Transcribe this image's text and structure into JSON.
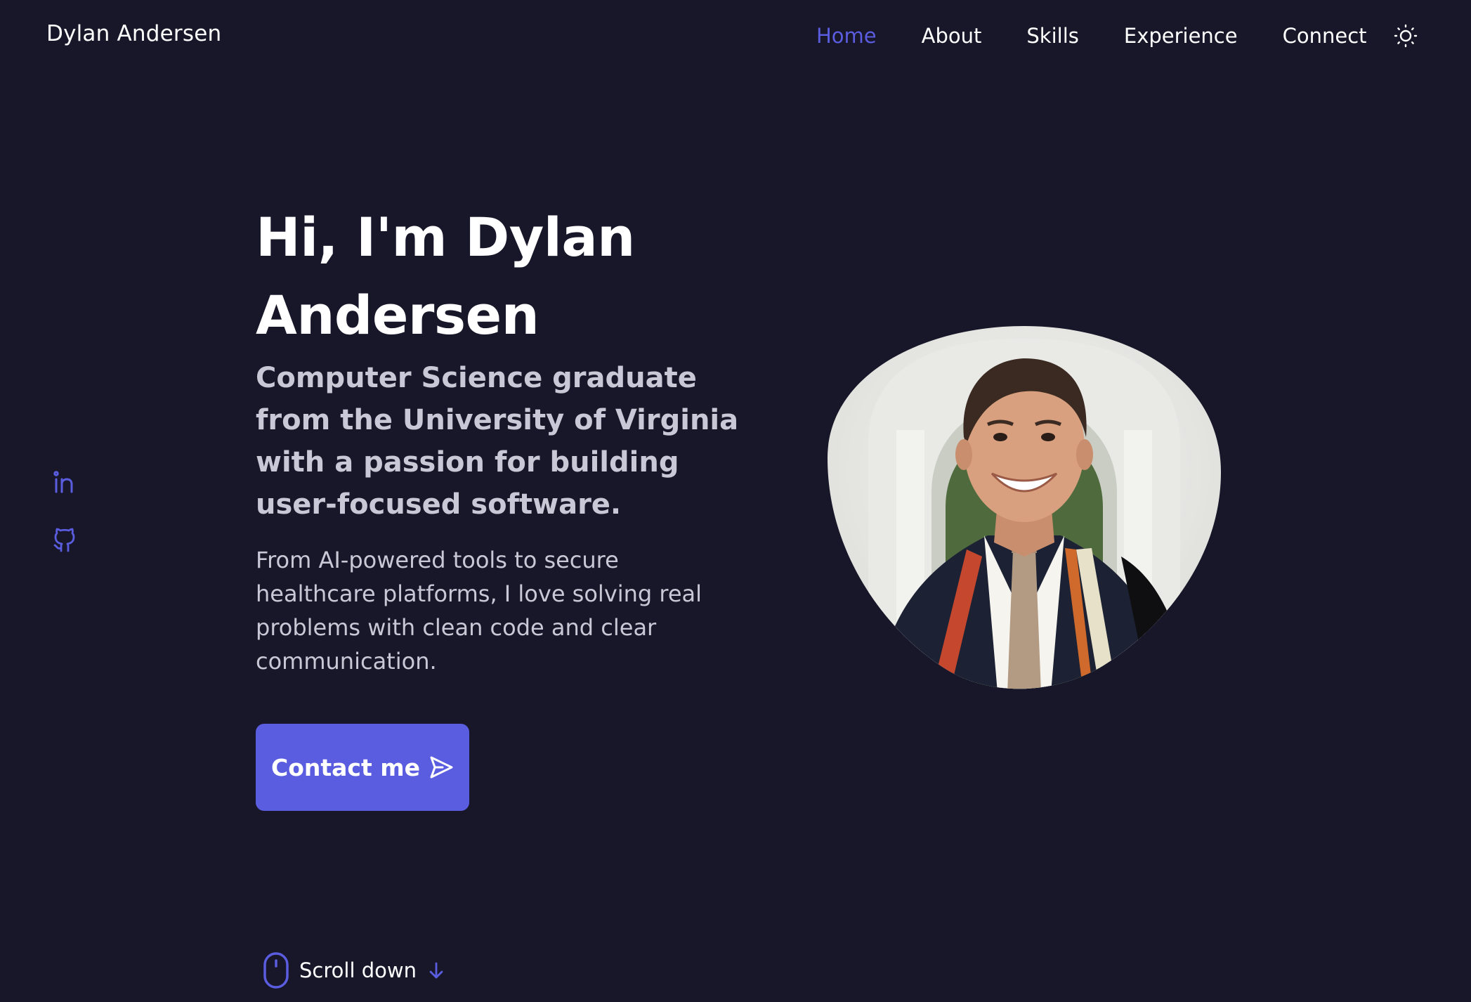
{
  "header": {
    "logo": "Dylan Andersen",
    "nav": [
      {
        "label": "Home",
        "active": true
      },
      {
        "label": "About",
        "active": false
      },
      {
        "label": "Skills",
        "active": false
      },
      {
        "label": "Experience",
        "active": false
      },
      {
        "label": "Connect",
        "active": false
      }
    ],
    "theme_toggle_icon": "sun-icon"
  },
  "social": [
    {
      "icon": "linkedin-icon"
    },
    {
      "icon": "github-icon"
    }
  ],
  "hero": {
    "title": "Hi, I'm Dylan Andersen",
    "subtitle": "Computer Science graduate from the University of Virginia with a passion for building user-focused software.",
    "description": "From AI-powered tools to secure healthcare platforms, I love solving real problems with clean code and clear communication.",
    "contact_label": "Contact me",
    "contact_icon": "send-icon",
    "scroll_label": "Scroll down",
    "scroll_icons": [
      "mouse-icon",
      "arrow-down-icon"
    ],
    "portrait": "profile-photo"
  },
  "colors": {
    "background": "#181729",
    "accent": "#5b5de0",
    "text": "#ffffff",
    "muted_text": "#c9c8d6"
  }
}
